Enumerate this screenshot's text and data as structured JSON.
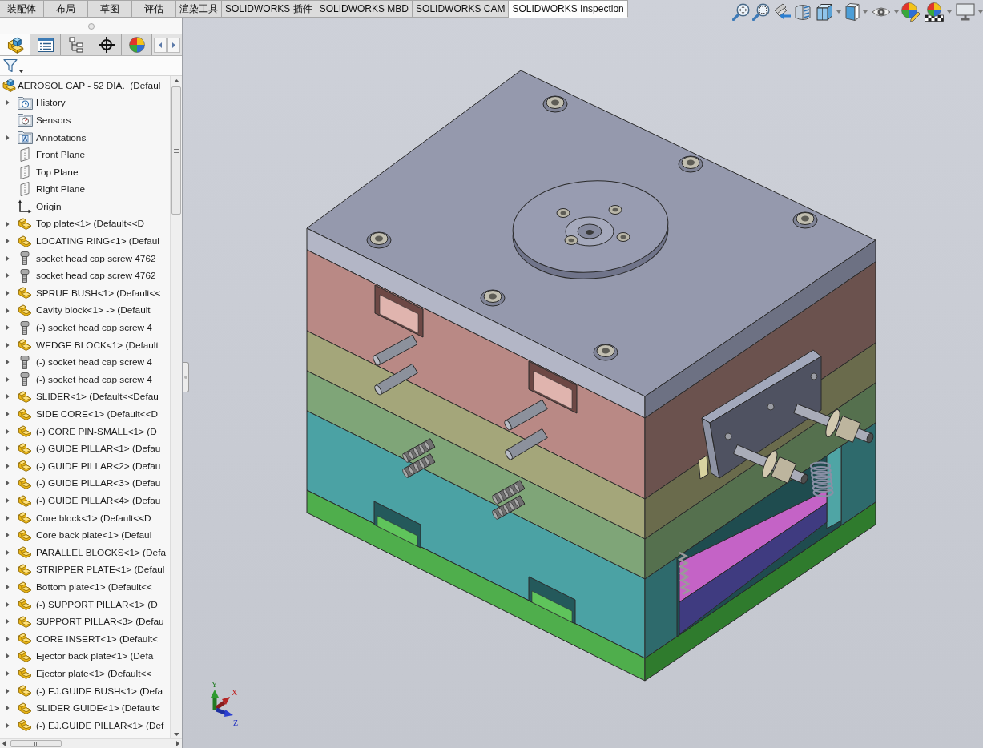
{
  "ribbon_tabs": [
    {
      "label": "装配体",
      "selected": false
    },
    {
      "label": "布局",
      "selected": false
    },
    {
      "label": "草图",
      "selected": false
    },
    {
      "label": "评估",
      "selected": false
    },
    {
      "label": "渲染工具",
      "selected": false
    },
    {
      "label": "SOLIDWORKS 插件",
      "selected": false
    },
    {
      "label": "SOLIDWORKS MBD",
      "selected": false
    },
    {
      "label": "SOLIDWORKS CAM",
      "selected": false
    },
    {
      "label": "SOLIDWORKS Inspection",
      "selected": true
    }
  ],
  "panel_tabs": [
    {
      "kind": "features",
      "selected": true
    },
    {
      "kind": "properties",
      "selected": false
    },
    {
      "kind": "configurations",
      "selected": false
    },
    {
      "kind": "dimxpert",
      "selected": false
    },
    {
      "kind": "display",
      "selected": false
    }
  ],
  "feature_tree": {
    "label": "AEROSOL CAP - 52 DIA.  (Defaul",
    "kind": "assembly",
    "children": [
      {
        "label": "History",
        "kind": "history",
        "expandable": true
      },
      {
        "label": "Sensors",
        "kind": "sensors",
        "expandable": false
      },
      {
        "label": "Annotations",
        "kind": "annotations",
        "expandable": true
      },
      {
        "label": "Front Plane",
        "kind": "plane",
        "expandable": false
      },
      {
        "label": "Top Plane",
        "kind": "plane",
        "expandable": false
      },
      {
        "label": "Right Plane",
        "kind": "plane",
        "expandable": false
      },
      {
        "label": "Origin",
        "kind": "origin",
        "expandable": false
      },
      {
        "label": "Top plate<1> (Default<<D",
        "kind": "part",
        "expandable": true
      },
      {
        "label": "LOCATING RING<1> (Defaul",
        "kind": "part",
        "expandable": true
      },
      {
        "label": "socket head cap screw 4762",
        "kind": "fastener",
        "expandable": true
      },
      {
        "label": "socket head cap screw 4762",
        "kind": "fastener",
        "expandable": true
      },
      {
        "label": "SPRUE BUSH<1> (Default<<",
        "kind": "part",
        "expandable": true
      },
      {
        "label": "Cavity block<1> -> (Default",
        "kind": "part",
        "expandable": true
      },
      {
        "label": "(-) socket head cap screw 4",
        "kind": "fastener",
        "expandable": true
      },
      {
        "label": "WEDGE BLOCK<1> (Default",
        "kind": "part",
        "expandable": true
      },
      {
        "label": "(-) socket head cap screw 4",
        "kind": "fastener",
        "expandable": true
      },
      {
        "label": "(-) socket head cap screw 4",
        "kind": "fastener",
        "expandable": true
      },
      {
        "label": "SLIDER<1> (Default<<Defau",
        "kind": "part",
        "expandable": true
      },
      {
        "label": "SIDE CORE<1> (Default<<D",
        "kind": "part",
        "expandable": true
      },
      {
        "label": "(-) CORE PIN-SMALL<1> (D",
        "kind": "part",
        "expandable": true
      },
      {
        "label": "(-) GUIDE PILLAR<1> (Defau",
        "kind": "part",
        "expandable": true
      },
      {
        "label": "(-) GUIDE PILLAR<2> (Defau",
        "kind": "part",
        "expandable": true
      },
      {
        "label": "(-) GUIDE PILLAR<3> (Defau",
        "kind": "part",
        "expandable": true
      },
      {
        "label": "(-) GUIDE PILLAR<4> (Defau",
        "kind": "part",
        "expandable": true
      },
      {
        "label": "Core block<1> (Default<<D",
        "kind": "part",
        "expandable": true
      },
      {
        "label": "Core back plate<1> (Defaul",
        "kind": "part",
        "expandable": true
      },
      {
        "label": "PARALLEL BLOCKS<1> (Defa",
        "kind": "part",
        "expandable": true
      },
      {
        "label": "STRIPPER PLATE<1> (Defaul",
        "kind": "part",
        "expandable": true
      },
      {
        "label": "Bottom plate<1> (Default<<",
        "kind": "part",
        "expandable": true
      },
      {
        "label": "(-) SUPPORT PILLAR<1> (D",
        "kind": "part",
        "expandable": true
      },
      {
        "label": "SUPPORT PILLAR<3> (Defau",
        "kind": "part",
        "expandable": true
      },
      {
        "label": "CORE INSERT<1> (Default<",
        "kind": "part",
        "expandable": true
      },
      {
        "label": "Ejector back plate<1> (Defa",
        "kind": "part",
        "expandable": true
      },
      {
        "label": "Ejector plate<1> (Default<<",
        "kind": "part",
        "expandable": true
      },
      {
        "label": "(-) EJ.GUIDE BUSH<1> (Defa",
        "kind": "part",
        "expandable": true
      },
      {
        "label": "SLIDER GUIDE<1> (Default<",
        "kind": "part",
        "expandable": true
      },
      {
        "label": "(-) EJ.GUIDE PILLAR<1> (Def",
        "kind": "part",
        "expandable": true
      }
    ]
  },
  "triad": {
    "x": "X",
    "y": "Y",
    "z": "Z"
  }
}
